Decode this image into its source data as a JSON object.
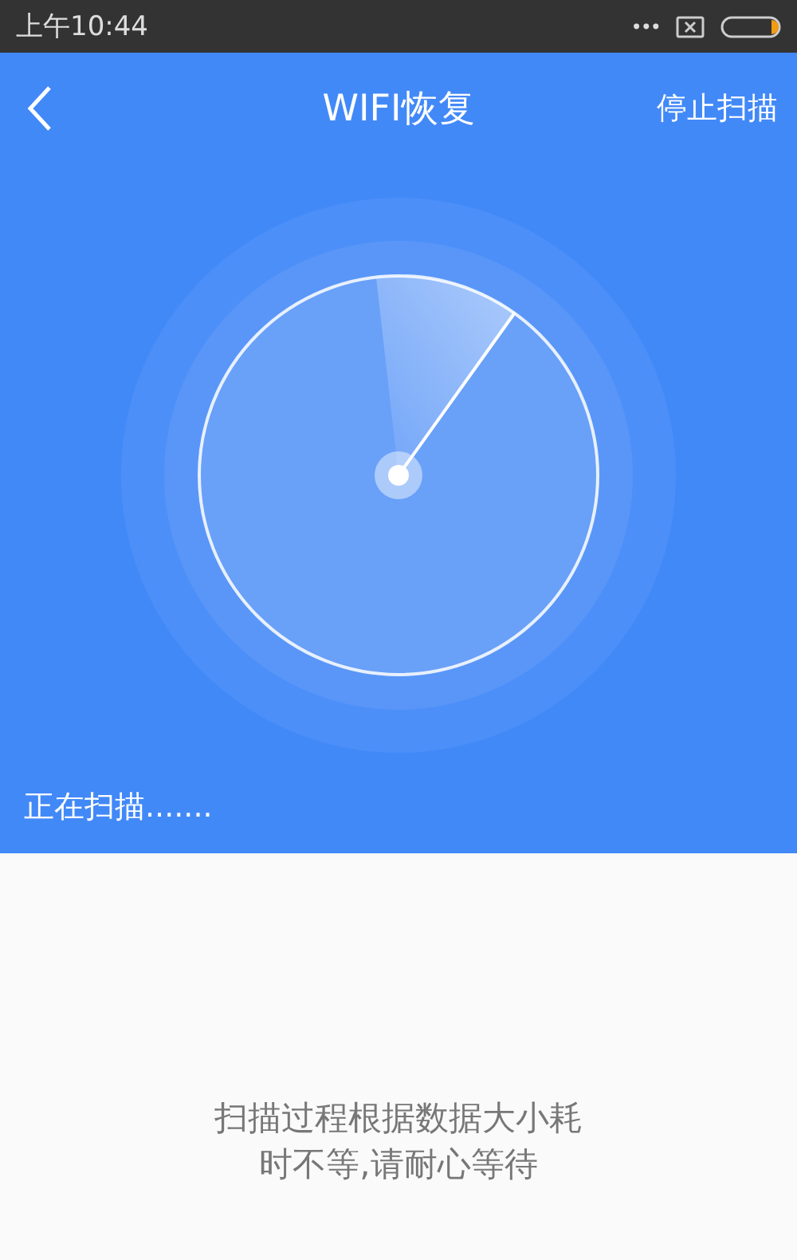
{
  "status_bar": {
    "time": "上午10:44",
    "dots": "•••"
  },
  "nav": {
    "title": "WIFI恢复",
    "action": "停止扫描"
  },
  "scan": {
    "status": "正在扫描......."
  },
  "hint_lines": [
    "扫描过程根据数据大小耗",
    "时不等,请耐心等待"
  ]
}
